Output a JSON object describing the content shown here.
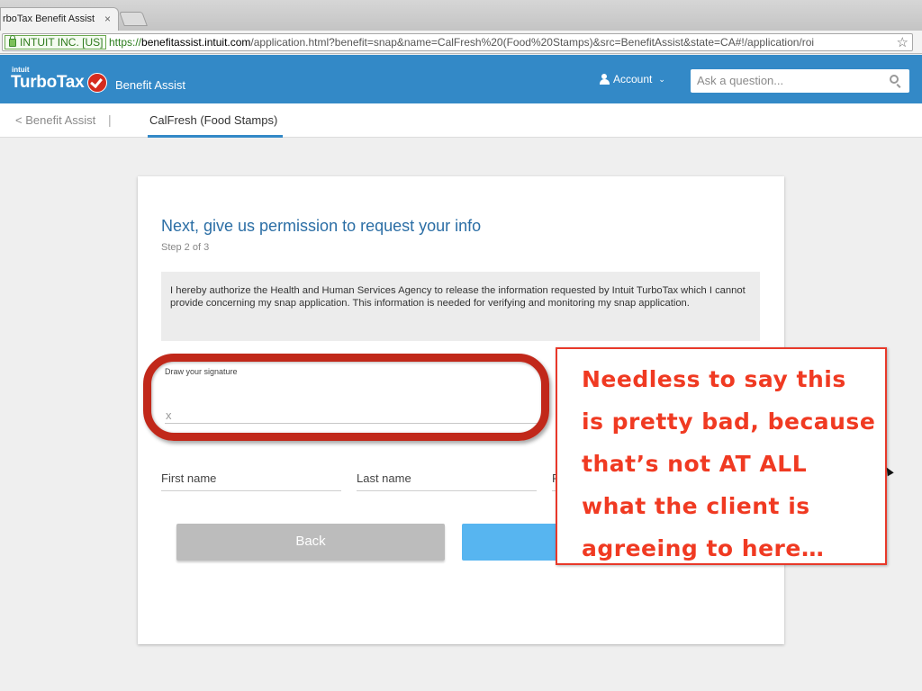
{
  "browser": {
    "tab_title": "rboTax Benefit Assist",
    "tab_close": "×",
    "ev_label": "INTUIT INC. [US]",
    "url_scheme": "https://",
    "url_host": "benefitassist.intuit.com",
    "url_path": "/application.html?benefit=snap&name=CalFresh%20(Food%20Stamps)&src=BenefitAssist&state=CA#!/application/roi",
    "bookmark_star": "☆"
  },
  "header": {
    "brand_small": "intuit",
    "brand_name": "TurboTax",
    "product": "Benefit Assist",
    "account_label": "Account",
    "search_placeholder": "Ask a question..."
  },
  "subnav": {
    "back_label": "< Benefit Assist",
    "separator": "|",
    "active_tab": "CalFresh (Food Stamps)"
  },
  "card": {
    "title": "Next, give us permission to request your info",
    "step": "Step 2 of 3",
    "authorization_text": "I hereby authorize the Health and Human Services Agency to release the information requested by Intuit TurboTax which I cannot provide concerning my snap application. This information is needed for verifying and monitoring my snap application.",
    "signature_label": "Draw your signature",
    "signature_x": "x",
    "first_name_label": "First name",
    "last_name_label": "Last name",
    "third_field_label": "F",
    "back_button": "Back"
  },
  "annotation": {
    "callout_text": "Needless to say this is pretty bad, because that’s not AT ALL what the client is agreeing to here…",
    "colors": {
      "ring": "#c1281a",
      "callout_text": "#f03a22"
    }
  },
  "colors": {
    "header_bg": "#3389c7",
    "next_button": "#57b5f0",
    "back_button": "#bcbcbc"
  }
}
